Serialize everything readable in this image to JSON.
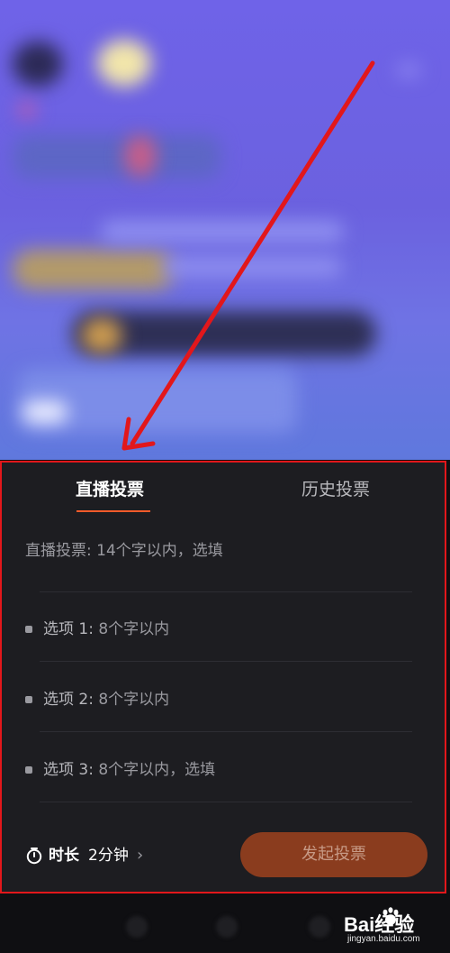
{
  "tabs": {
    "live_vote": "直播投票",
    "history_vote": "历史投票"
  },
  "vote_title": {
    "placeholder": "直播投票: 14个字以内，选填"
  },
  "options": [
    {
      "label": "选项 1:",
      "placeholder": "8个字以内"
    },
    {
      "label": "选项 2:",
      "placeholder": "8个字以内"
    },
    {
      "label": "选项 3:",
      "placeholder": "8个字以内，选填"
    }
  ],
  "duration": {
    "label": "时长",
    "value": "2分钟",
    "chevron": "›"
  },
  "start_button": {
    "label": "发起投票"
  },
  "watermark": {
    "brand": "Bai经验",
    "url": "jingyan.baidu.com"
  },
  "colors": {
    "accent": "#f25a2a",
    "annotation": "#e2171b",
    "button": "#8a3c1e"
  }
}
